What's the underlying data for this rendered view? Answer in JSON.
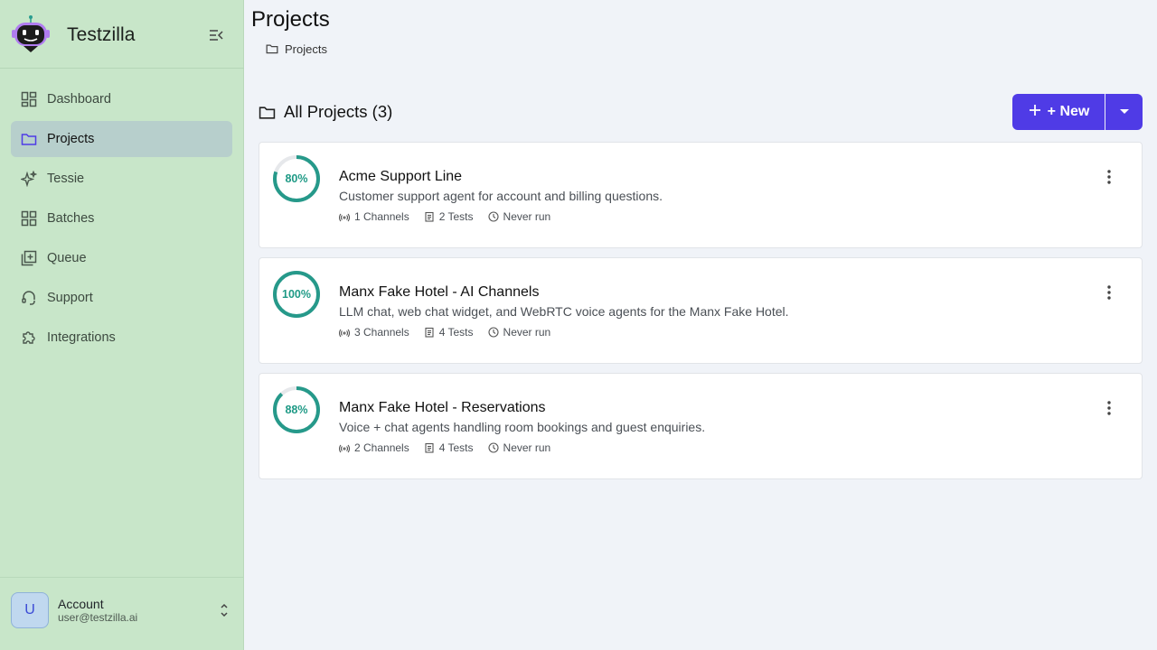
{
  "brand": {
    "name": "Testzilla"
  },
  "sidebar": {
    "items": [
      {
        "label": "Dashboard",
        "icon": "dashboard-icon",
        "active": false
      },
      {
        "label": "Projects",
        "icon": "folder-icon",
        "active": true
      },
      {
        "label": "Tessie",
        "icon": "sparkles-icon",
        "active": false
      },
      {
        "label": "Batches",
        "icon": "grid-icon",
        "active": false
      },
      {
        "label": "Queue",
        "icon": "queue-icon",
        "active": false
      },
      {
        "label": "Support",
        "icon": "support-icon",
        "active": false
      },
      {
        "label": "Integrations",
        "icon": "puzzle-icon",
        "active": false
      }
    ]
  },
  "account": {
    "initial": "U",
    "name": "Account",
    "email": "user@testzilla.ai"
  },
  "page": {
    "title": "Projects",
    "breadcrumb": "Projects"
  },
  "section": {
    "title": "All Projects (3)"
  },
  "toolbar": {
    "new_label": "+ New",
    "plus_glyph": "+"
  },
  "colors": {
    "accent": "#4f3be6",
    "ring": "#26998a",
    "sidebar": "#c8e6c9"
  },
  "projects": [
    {
      "score": 0.8,
      "score_label": "80%",
      "name": "Acme Support Line",
      "description": "Customer support agent for account and billing questions.",
      "channels": "1 Channels",
      "tests": "2 Tests",
      "last_run": "Never run"
    },
    {
      "score": 1.0,
      "score_label": "100%",
      "name": "Manx Fake Hotel - AI Channels",
      "description": "LLM chat, web chat widget, and WebRTC voice agents for the Manx Fake Hotel.",
      "channels": "3 Channels",
      "tests": "4 Tests",
      "last_run": "Never run"
    },
    {
      "score": 0.88,
      "score_label": "88%",
      "name": "Manx Fake Hotel - Reservations",
      "description": "Voice + chat agents handling room bookings and guest enquiries.",
      "channels": "2 Channels",
      "tests": "4 Tests",
      "last_run": "Never run"
    }
  ]
}
